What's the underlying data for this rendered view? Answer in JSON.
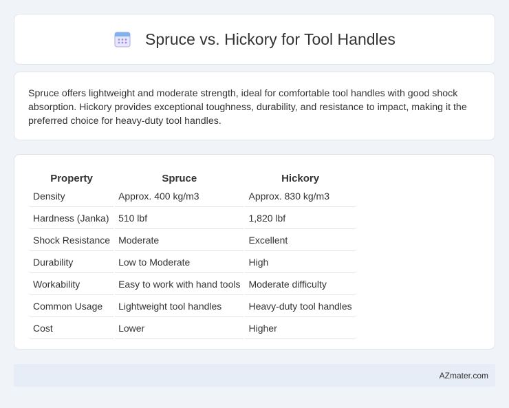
{
  "header": {
    "title": "Spruce vs. Hickory for Tool Handles",
    "icon": "calendar-icon"
  },
  "summary": {
    "text": "Spruce offers lightweight and moderate strength, ideal for comfortable tool handles with good shock absorption. Hickory provides exceptional toughness, durability, and resistance to impact, making it the preferred choice for heavy-duty tool handles."
  },
  "table": {
    "headers": [
      "Property",
      "Spruce",
      "Hickory"
    ],
    "rows": [
      [
        "Density",
        "Approx. 400 kg/m3",
        "Approx. 830 kg/m3"
      ],
      [
        "Hardness (Janka)",
        "510 lbf",
        "1,820 lbf"
      ],
      [
        "Shock Resistance",
        "Moderate",
        "Excellent"
      ],
      [
        "Durability",
        "Low to Moderate",
        "High"
      ],
      [
        "Workability",
        "Easy to work with hand tools",
        "Moderate difficulty"
      ],
      [
        "Common Usage",
        "Lightweight tool handles",
        "Heavy-duty tool handles"
      ],
      [
        "Cost",
        "Lower",
        "Higher"
      ]
    ]
  },
  "footer": {
    "text": "AZmater.com"
  },
  "colors": {
    "background": "#f0f3f8",
    "card": "#ffffff",
    "footer_bar": "#e6edf7",
    "icon_accent": "#7b7fd6"
  }
}
